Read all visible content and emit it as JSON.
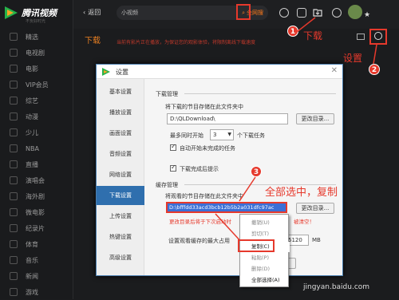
{
  "app": {
    "name": "腾讯视频",
    "slogan": "不负好时光"
  },
  "sidebar": {
    "items": [
      {
        "label": "精选"
      },
      {
        "label": "电视剧"
      },
      {
        "label": "电影"
      },
      {
        "label": "VIP会员"
      },
      {
        "label": "综艺"
      },
      {
        "label": "动漫"
      },
      {
        "label": "少儿"
      },
      {
        "label": "NBA"
      },
      {
        "label": "直播"
      },
      {
        "label": "演唱会"
      },
      {
        "label": "海外剧"
      },
      {
        "label": "微电影"
      },
      {
        "label": "纪录片"
      },
      {
        "label": "体育"
      },
      {
        "label": "音乐"
      },
      {
        "label": "新闻"
      },
      {
        "label": "游戏"
      }
    ]
  },
  "topbar": {
    "back_label": "返回",
    "search_value": "小视频",
    "search_scope": "全网搜"
  },
  "page": {
    "title": "下载",
    "notice": "当前有影片正在播放，为保证您的观影体验，将限制离线下载速度"
  },
  "annotations": {
    "download": "下载",
    "settings": "设置",
    "copy_all": "全部选中，复制",
    "step1": "1",
    "step2": "2",
    "step3": "3"
  },
  "dialog": {
    "title": "设置",
    "nav": [
      {
        "label": "基本设置"
      },
      {
        "label": "播放设置"
      },
      {
        "label": "画面设置"
      },
      {
        "label": "音频设置"
      },
      {
        "label": "网络设置"
      },
      {
        "label": "下载设置"
      },
      {
        "label": "上传设置"
      },
      {
        "label": "热键设置"
      },
      {
        "label": "高级设置"
      }
    ],
    "download_section": "下载管理",
    "save_folder_label": "将下载的节目存储在此文件夹中",
    "save_folder_value": "D:\\QLDownload\\",
    "change_dir": "更改目录...",
    "max_tasks_prefix": "最多同时开始",
    "max_tasks_value": "3",
    "max_tasks_suffix": "个下载任务",
    "auto_start": "自动开始未完成的任务",
    "done_tip": "下载完成后提示",
    "cache_section": "缓存管理",
    "cache_folder_label": "将观看的节目存储在此文件夹中",
    "cache_folder_value": "D:\\bfffdd33acd3bcb12b5b2a031dfc97ac",
    "cache_warn_left": "更改目录后将于下次启动时",
    "cache_warn_right": "被清空！",
    "cache_size_label": "设置观看缓存的最大占用",
    "cache_size_value": "5120",
    "cache_size_unit": "MB",
    "ok_fragment": "消"
  },
  "context_menu": {
    "items": [
      {
        "label": "撤销(U)"
      },
      {
        "label": "剪切(T)"
      },
      {
        "label": "复制(C)"
      },
      {
        "label": "粘贴(P)"
      },
      {
        "label": "删除(D)"
      },
      {
        "label": "全部选择(A)"
      }
    ]
  },
  "watermark": "jingyan.baidu.com",
  "colors": {
    "accent": "#ff7a1a",
    "annotation": "#e6392c",
    "selection": "#3b6fd6",
    "nav_active": "#2f6fae"
  }
}
